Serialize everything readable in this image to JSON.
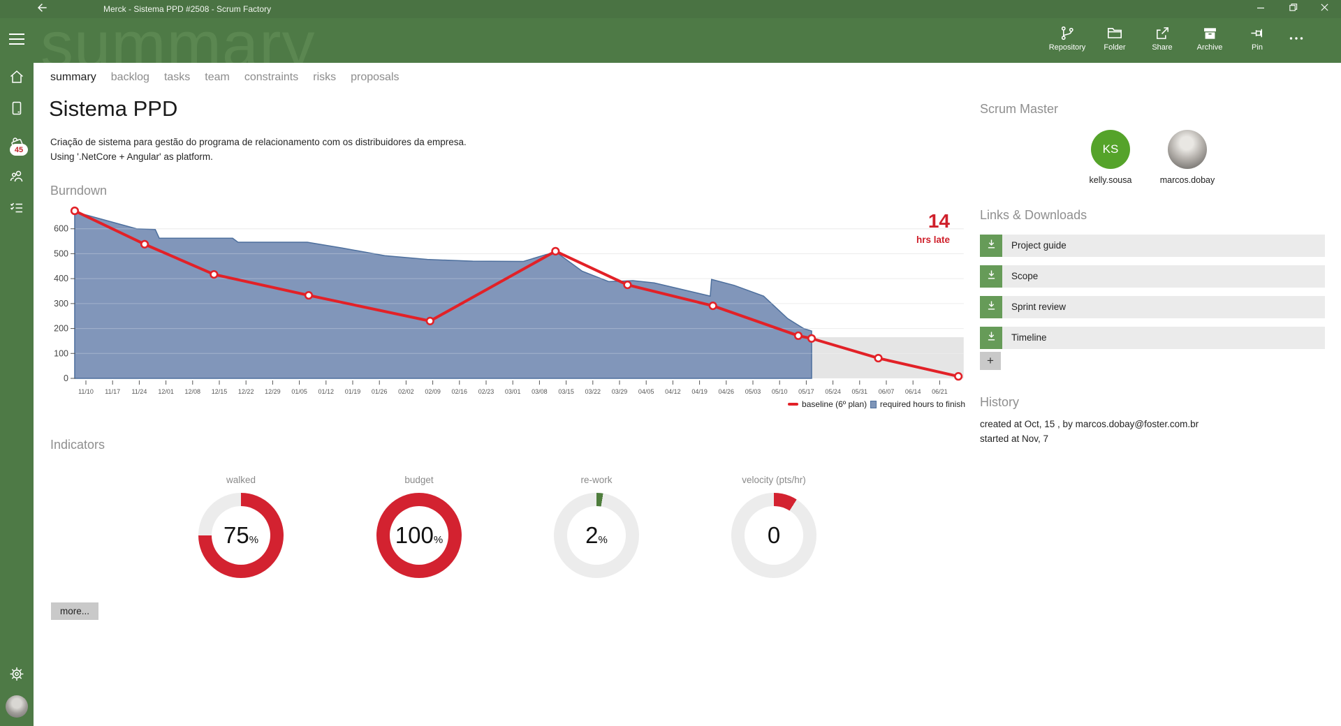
{
  "titlebar": {
    "title": "Merck - Sistema PPD #2508 - Scrum Factory"
  },
  "header": {
    "watermark": "summary",
    "toolbar": [
      {
        "id": "repository",
        "icon": "repo",
        "label": "Repository"
      },
      {
        "id": "folder",
        "icon": "folder",
        "label": "Folder"
      },
      {
        "id": "share",
        "icon": "share",
        "label": "Share"
      },
      {
        "id": "archive",
        "icon": "archive",
        "label": "Archive"
      },
      {
        "id": "pin",
        "icon": "pin",
        "label": "Pin"
      },
      {
        "id": "more",
        "icon": "dots",
        "label": ""
      }
    ]
  },
  "sidebar": {
    "badge_count": "45"
  },
  "tabs": {
    "active_index": 0,
    "items": [
      "summary",
      "backlog",
      "tasks",
      "team",
      "constraints",
      "risks",
      "proposals"
    ]
  },
  "project": {
    "title": "Sistema PPD",
    "desc1": "Criação de sistema para gestão do programa de relacionamento com os distribuidores da empresa.",
    "desc2": "Using '.NetCore + Angular' as platform."
  },
  "burndown": {
    "title": "Burndown",
    "late_value": "14",
    "late_label": "hrs late",
    "legend": [
      {
        "swatch": "line",
        "color": "#e22127",
        "border": "#e22127",
        "label": "baseline (6º plan)"
      },
      {
        "swatch": "square",
        "color": "#7e95b8",
        "border": "#4c6e9c",
        "label": "required hours to finish"
      }
    ]
  },
  "chart_data": {
    "type": "area+line",
    "title": "Burndown",
    "x_tick_labels": [
      "11/10",
      "11/17",
      "11/24",
      "12/01",
      "12/08",
      "12/15",
      "12/22",
      "12/29",
      "01/05",
      "01/12",
      "01/19",
      "01/26",
      "02/02",
      "02/09",
      "02/16",
      "02/23",
      "03/01",
      "03/08",
      "03/15",
      "03/22",
      "03/29",
      "04/05",
      "04/12",
      "04/19",
      "04/26",
      "05/03",
      "05/10",
      "05/17",
      "05/24",
      "05/31",
      "06/07",
      "06/14",
      "06/21"
    ],
    "yticks": [
      0,
      100,
      200,
      300,
      400,
      500,
      600
    ],
    "ylim": [
      0,
      700
    ],
    "grid": true,
    "legend_position": "bottom-right",
    "series": [
      {
        "name": "baseline (6º plan)",
        "type": "line",
        "color": "#e22127",
        "points": [
          [
            -0.42,
            672
          ],
          [
            2.2,
            538
          ],
          [
            4.8,
            417
          ],
          [
            8.35,
            333
          ],
          [
            12.9,
            230
          ],
          [
            17.6,
            510
          ],
          [
            20.3,
            375
          ],
          [
            23.5,
            291
          ],
          [
            26.7,
            171
          ],
          [
            27.2,
            160
          ],
          [
            29.7,
            81
          ],
          [
            32.7,
            8
          ]
        ]
      },
      {
        "name": "required hours to finish",
        "type": "area",
        "fill": "#8196ba",
        "stroke": "#4d6f9d",
        "points": [
          [
            -0.42,
            668
          ],
          [
            1.9,
            600
          ],
          [
            2.6,
            597
          ],
          [
            2.75,
            562
          ],
          [
            5.5,
            562
          ],
          [
            5.7,
            546
          ],
          [
            8.3,
            546
          ],
          [
            9.6,
            523
          ],
          [
            11.2,
            492
          ],
          [
            12.8,
            477
          ],
          [
            14.5,
            470
          ],
          [
            16.4,
            469
          ],
          [
            17.6,
            508
          ],
          [
            18.6,
            430
          ],
          [
            19.6,
            388
          ],
          [
            20.5,
            392
          ],
          [
            21.3,
            383
          ],
          [
            23.4,
            330
          ],
          [
            23.45,
            397
          ],
          [
            24.3,
            373
          ],
          [
            25.4,
            330
          ],
          [
            26.3,
            240
          ],
          [
            26.9,
            200
          ],
          [
            27.2,
            190
          ]
        ]
      }
    ],
    "projection": {
      "from_week": 27.2,
      "to_week": 32.9,
      "top_value": 165,
      "color": "#e5e5e5"
    },
    "annotation": {
      "value": "14",
      "label": "hrs late",
      "color": "#cf202b"
    }
  },
  "indicators": {
    "title": "Indicators",
    "more_label": "more...",
    "items": [
      {
        "label": "walked",
        "value": "75",
        "unit": "%",
        "arc_percent": 75,
        "color": "#d32230",
        "track": "#ececec"
      },
      {
        "label": "budget",
        "value": "100",
        "unit": "%",
        "arc_percent": 100,
        "color": "#d32230",
        "track": "#ececec"
      },
      {
        "label": "re-work",
        "value": "2",
        "unit": "%",
        "arc_percent": 2.5,
        "color": "#4e7d3c",
        "track": "#ececec"
      },
      {
        "label": "velocity (pts/hr)",
        "value": "0",
        "unit": "",
        "arc_percent": 9,
        "color": "#d32230",
        "track": "#ececec"
      }
    ]
  },
  "scrum_master": {
    "title": "Scrum Master",
    "members": [
      {
        "name": "kelly.sousa",
        "avatar": "initials",
        "initials": "KS",
        "color": "#55a32a"
      },
      {
        "name": "marcos.dobay",
        "avatar": "photo",
        "initials": ""
      }
    ]
  },
  "links": {
    "title": "Links & Downloads",
    "add_label": "+",
    "items": [
      {
        "label": "Project guide"
      },
      {
        "label": "Scope"
      },
      {
        "label": "Sprint review"
      },
      {
        "label": "Timeline"
      }
    ]
  },
  "history": {
    "title": "History",
    "lines": [
      "created at Oct, 15 , by marcos.dobay@foster.com.br",
      "started at Nov, 7"
    ]
  }
}
